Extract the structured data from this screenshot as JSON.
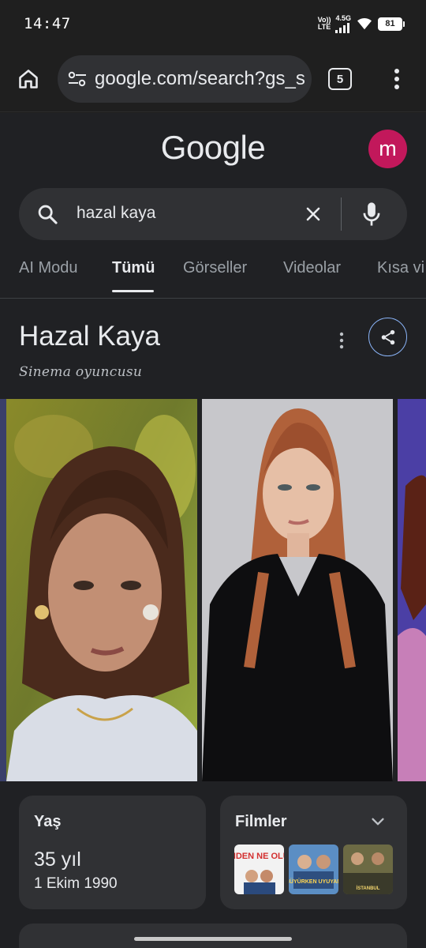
{
  "status_bar": {
    "time": "14:47",
    "network_voice": "Vo))",
    "network_lte": "LTE",
    "network_type": "4.5G",
    "battery": "81"
  },
  "browser": {
    "url": "google.com/search?gs_s",
    "tab_count": "5",
    "icons": [
      "home-icon",
      "site-settings-icon",
      "more-vert-icon"
    ]
  },
  "google": {
    "logo_text": "Google",
    "avatar_letter": "m",
    "avatar_color": "#c2185b"
  },
  "search": {
    "query": "hazal kaya",
    "icons": [
      "search-icon",
      "clear-icon",
      "mic-icon"
    ]
  },
  "tabs": [
    {
      "label": "AI Modu",
      "active": false
    },
    {
      "label": "Tümü",
      "active": true
    },
    {
      "label": "Görseller",
      "active": false
    },
    {
      "label": "Videolar",
      "active": false
    },
    {
      "label": "Kısa vi",
      "active": false
    }
  ],
  "entity": {
    "title": "Hazal Kaya",
    "subtitle": "Sinema oyuncusu"
  },
  "cards": {
    "age": {
      "label": "Yaş",
      "value": "35 yıl",
      "date": "1 Ekim 1990"
    },
    "films": {
      "label": "Filmler",
      "thumb_1_text": "BENDEN NE OLUR?",
      "thumb_2_text": "AY BÜYÜRKEN UYUYAMAM",
      "thumb_3_text": "İSTANBUL"
    }
  },
  "colors": {
    "background": "#202124",
    "surface": "#303134",
    "accent_blue": "#8ab4f8",
    "text_primary": "#e8eaed",
    "text_secondary": "#9aa0a6"
  }
}
